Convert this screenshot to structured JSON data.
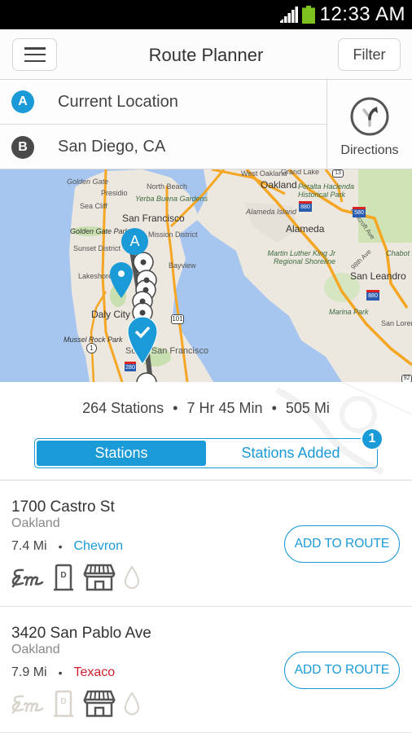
{
  "status_bar": {
    "time": "12:33 AM",
    "icons": [
      "signal-icon",
      "battery-icon"
    ],
    "battery_color": "#7dc21e"
  },
  "header": {
    "menu_icon": "hamburger-menu-icon",
    "title": "Route Planner",
    "filter_label": "Filter"
  },
  "route": {
    "start": {
      "badge": "A",
      "text": "Current Location"
    },
    "end": {
      "badge": "B",
      "text": "San Diego, CA"
    },
    "directions_label": "Directions",
    "directions_icon": "fork-arrow-icon"
  },
  "map": {
    "labels": {
      "golden_gate": "Golden Gate",
      "north_beach": "North Beach",
      "presidio": "Presidio",
      "yerba_buena": "Yerba Buena Gardens",
      "sea_cliff": "Sea Cliff",
      "san_francisco": "San Francisco",
      "golden_gate_park": "Golden Gate Park",
      "mission_district": "Mission District",
      "sunset_district": "Sunset District",
      "bayview": "Bayview",
      "lakeshore": "Lakeshore",
      "daly_city": "Daly City",
      "mussel_rock": "Mussel Rock Park",
      "south_sf": "South San Francisco",
      "west_oakland": "West Oakland",
      "grand_lake": "Grand Lake",
      "oakland": "Oakland",
      "peralta": "Peralta Hacienda Historical Park",
      "alameda_island": "Alameda Island",
      "alameda": "Alameda",
      "mlk_shoreline": "Martin Luther King Jr Regional Shoreline",
      "chabot": "Chabot R",
      "san_leandro": "San Leandro",
      "marina_park": "Marina Park",
      "san_lorenzo": "San Lorenz",
      "bancroft": "Bancroft Ave",
      "ave98": "98th Ave"
    },
    "shields": [
      "101",
      "1",
      "280",
      "880",
      "580",
      "13",
      "92"
    ],
    "markers": {
      "start_badge": "A",
      "selected_icon": "checkmark-icon"
    }
  },
  "summary": {
    "stations": "264 Stations",
    "duration": "7 Hr 45 Min",
    "distance": "505 Mi",
    "separator": "•"
  },
  "tabs": {
    "stations": "Stations",
    "stations_added": "Stations Added",
    "active": "stations",
    "added_count": "1"
  },
  "stations": [
    {
      "address": "1700 Castro St",
      "city": "Oakland",
      "distance": "7.4 Mi",
      "brand": "Chevron",
      "brand_color": "#1a9ad6",
      "amenities": [
        {
          "name": "e85-icon",
          "available": true
        },
        {
          "name": "diesel-icon",
          "available": true
        },
        {
          "name": "store-icon",
          "available": true
        },
        {
          "name": "water-drop-icon",
          "available": false
        }
      ],
      "action": "ADD TO ROUTE"
    },
    {
      "address": "3420 San Pablo Ave",
      "city": "Oakland",
      "distance": "7.9 Mi",
      "brand": "Texaco",
      "brand_color": "#d0202e",
      "amenities": [
        {
          "name": "e85-icon",
          "available": false
        },
        {
          "name": "diesel-icon",
          "available": false
        },
        {
          "name": "store-icon",
          "available": true
        },
        {
          "name": "water-drop-icon",
          "available": false
        }
      ],
      "action": "ADD TO ROUTE"
    }
  ],
  "colors": {
    "accent": "#1a9ad6",
    "icon_active": "#555555",
    "icon_inactive": "#d8d4cc"
  }
}
